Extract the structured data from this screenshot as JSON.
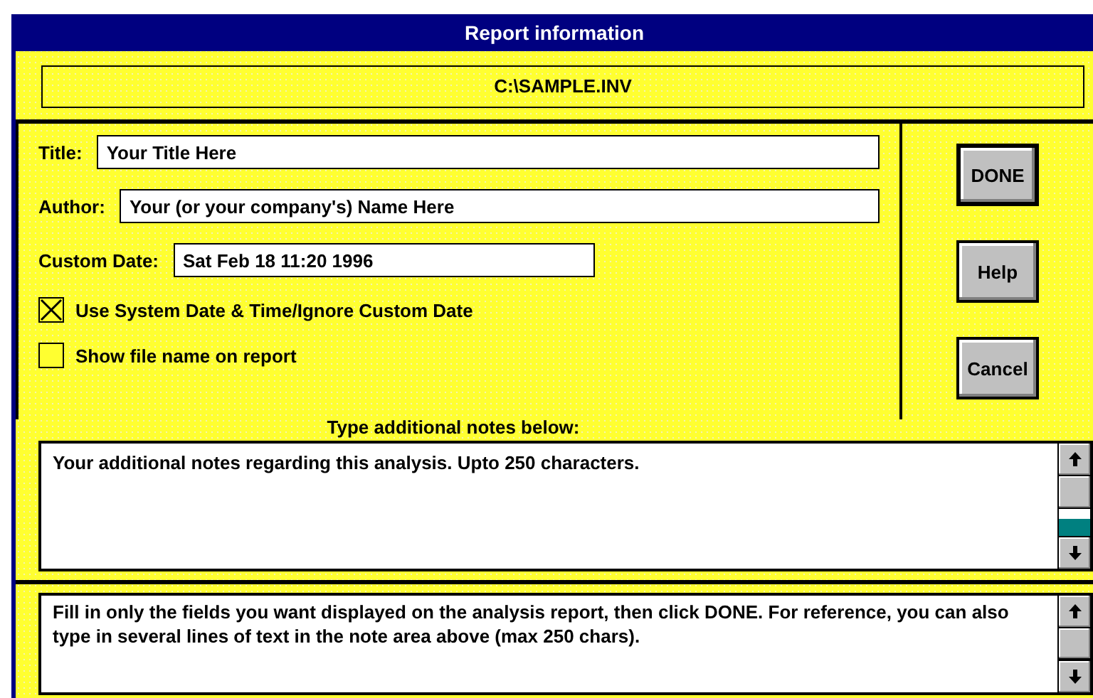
{
  "window": {
    "title": "Report information"
  },
  "file_name": "C:\\SAMPLE.INV",
  "fields": [
    {
      "label": "Title:",
      "value": "Your Title Here",
      "kind": "wide"
    },
    {
      "label": "Author:",
      "value": "Your (or your company's) Name Here",
      "kind": "wide"
    },
    {
      "label": "Custom Date:",
      "value": "Sat Feb 18 11:20 1996",
      "kind": "short"
    }
  ],
  "checkboxes": [
    {
      "label": "Use System Date & Time/Ignore Custom Date",
      "checked": true
    },
    {
      "label": "Show file name on report",
      "checked": false
    }
  ],
  "buttons": [
    {
      "label": "DONE",
      "default": true
    },
    {
      "label": "Help",
      "default": false
    },
    {
      "label": "Cancel",
      "default": false
    }
  ],
  "notes": {
    "heading": "Type additional notes below:",
    "value": "Your additional notes regarding this analysis. Upto 250 characters."
  },
  "help_text": "Fill in only the fields you want displayed on the analysis report, then click DONE. For reference, you can also type in several lines of text in the note area above (max 250 chars)."
}
